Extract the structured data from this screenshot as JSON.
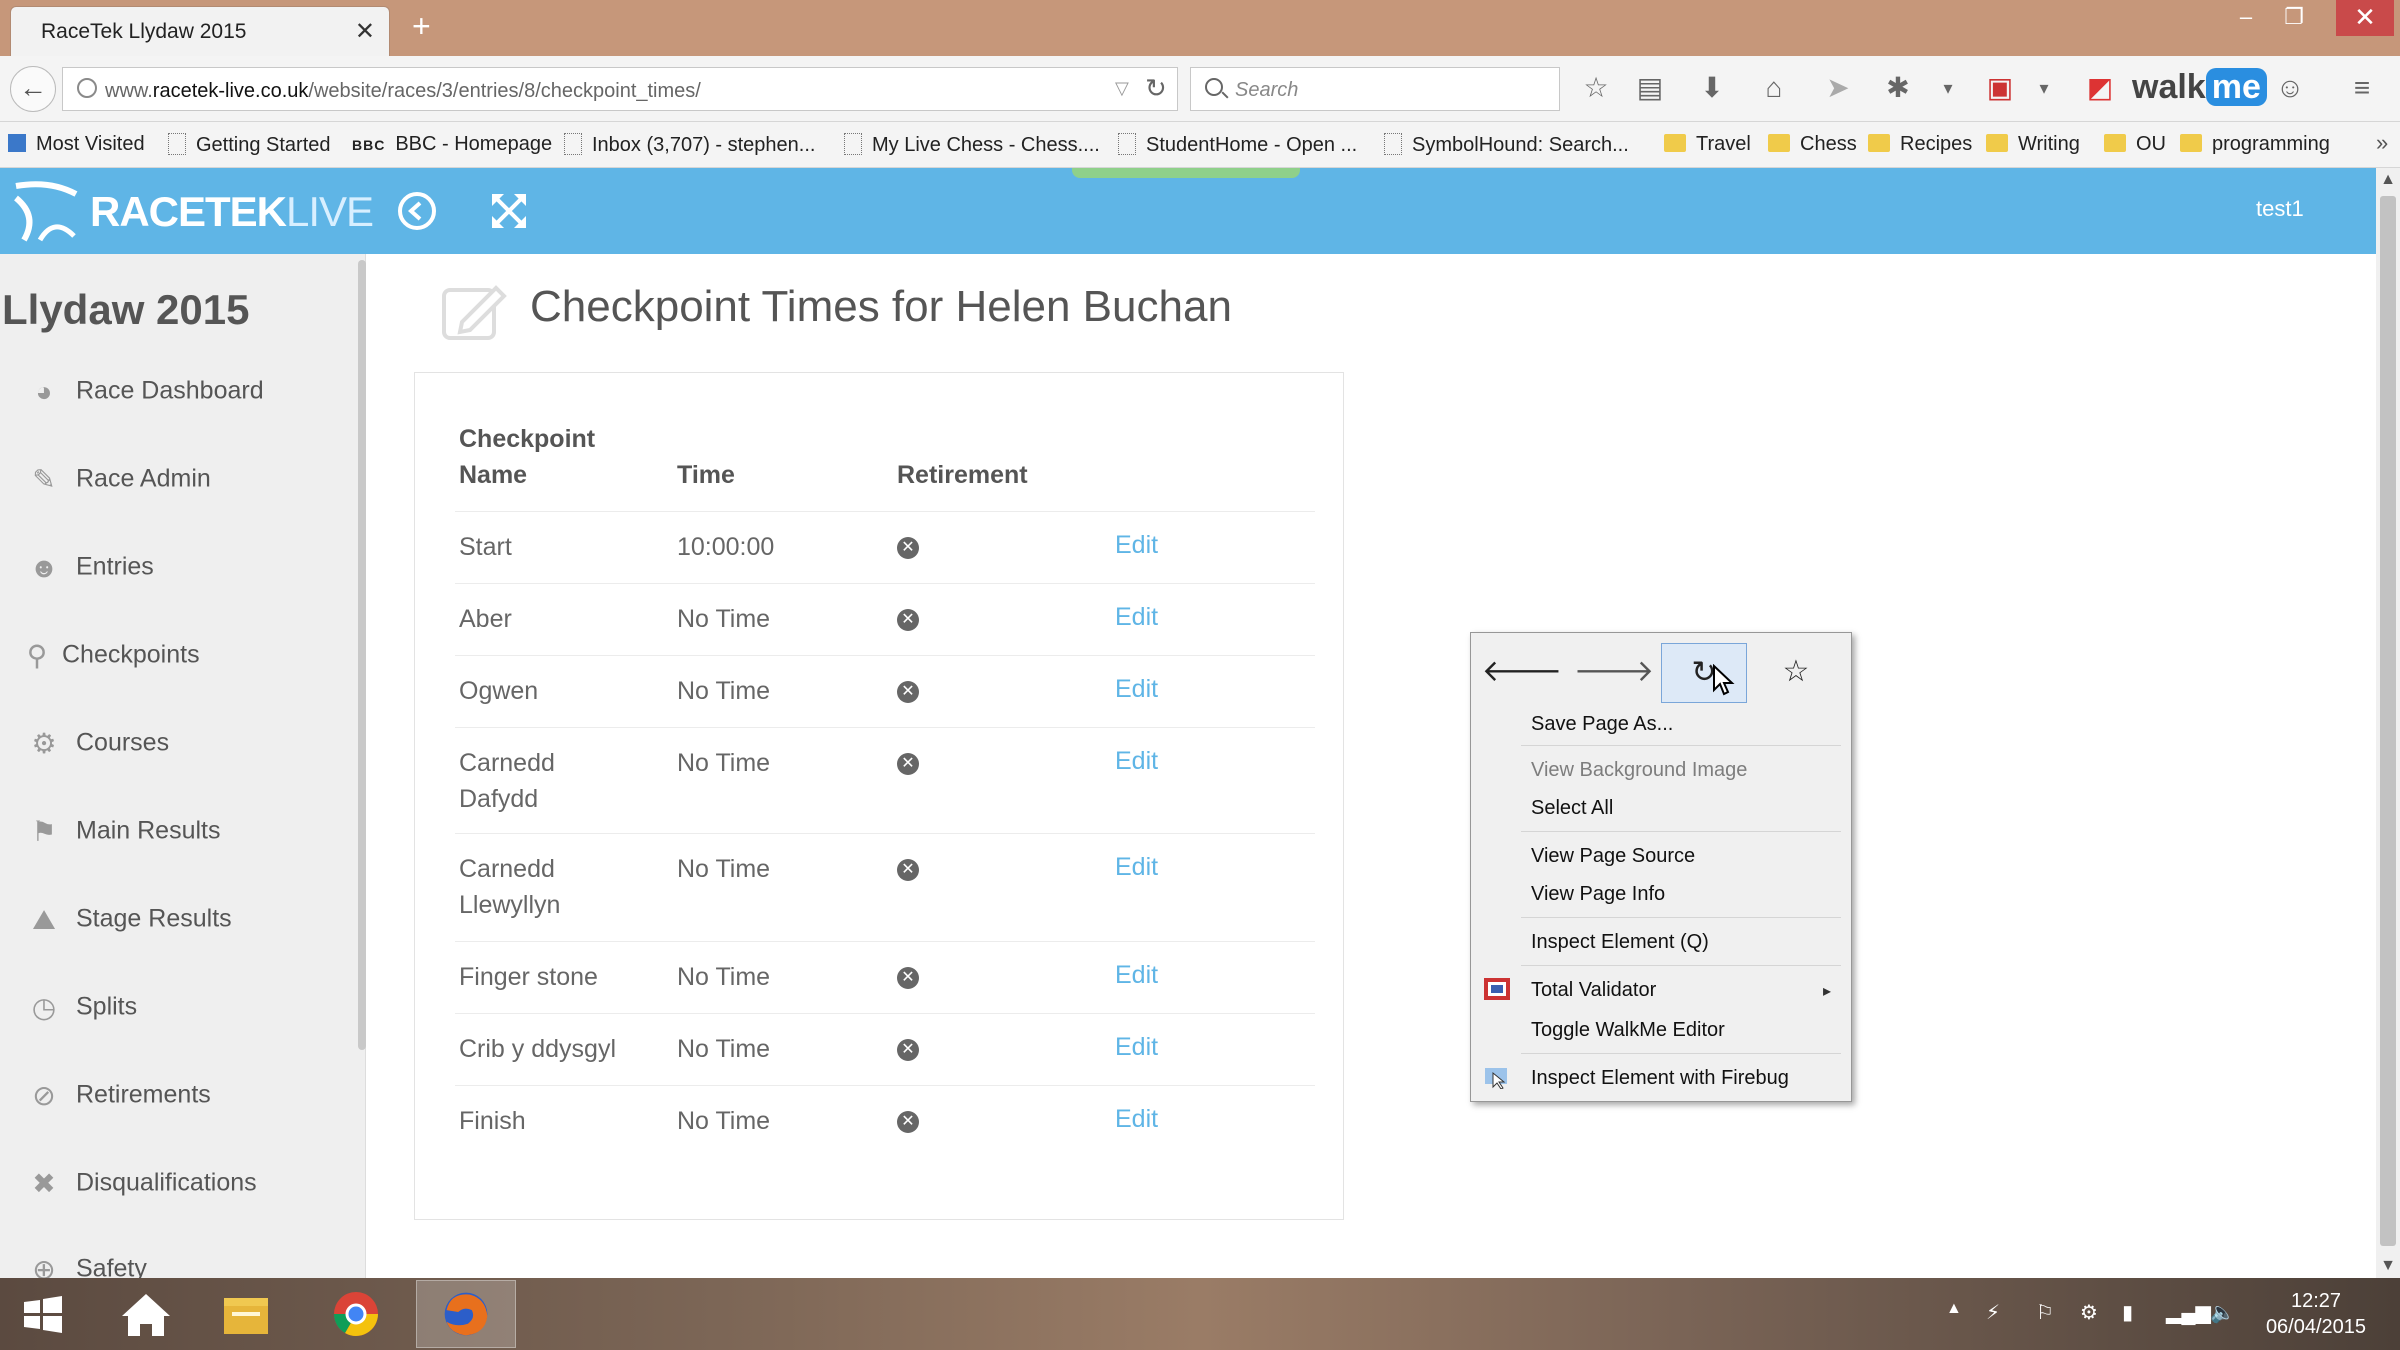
{
  "browser": {
    "tab_title": "RaceTek Llydaw 2015",
    "tab_close": "✕",
    "new_tab": "+",
    "url_prefix": "www.",
    "url_domain": "racetek-live.co.uk",
    "url_path": "/website/races/3/entries/8/checkpoint_times/",
    "search_placeholder": "Search",
    "window_min": "–",
    "window_max": "❐",
    "window_close": "✕",
    "walkme_a": "walk",
    "walkme_b": "me"
  },
  "bookmarks": [
    {
      "label": "Most Visited",
      "kind": "blue"
    },
    {
      "label": "Getting Started",
      "kind": "page"
    },
    {
      "label": "BBC - Homepage",
      "kind": "bbc"
    },
    {
      "label": "Inbox (3,707) - stephen...",
      "kind": "page"
    },
    {
      "label": "My Live Chess - Chess....",
      "kind": "page"
    },
    {
      "label": "StudentHome - Open ...",
      "kind": "page"
    },
    {
      "label": "SymbolHound: Search...",
      "kind": "page"
    },
    {
      "label": "Travel",
      "kind": "folder"
    },
    {
      "label": "Chess",
      "kind": "folder"
    },
    {
      "label": "Recipes",
      "kind": "folder"
    },
    {
      "label": "Writing",
      "kind": "folder"
    },
    {
      "label": "OU",
      "kind": "folder"
    },
    {
      "label": "programming",
      "kind": "folder"
    }
  ],
  "bbc_mark": "BBC",
  "bookmarks_more": "»",
  "app": {
    "logo_a": "RACETEK",
    "logo_b": "LIVE",
    "user": "test1",
    "event_title": "Llydaw 2015",
    "page_title": "Checkpoint Times for Helen Buchan",
    "colors": {
      "header": "#5fb5e6",
      "link": "#5fb5e6"
    }
  },
  "sidebar": {
    "items": [
      {
        "label": "Race Dashboard",
        "icon": "dashboard-icon"
      },
      {
        "label": "Race Admin",
        "icon": "edit-icon"
      },
      {
        "label": "Entries",
        "icon": "users-icon"
      },
      {
        "label": "Checkpoints",
        "icon": "map-marker-icon"
      },
      {
        "label": "Courses",
        "icon": "cogs-icon"
      },
      {
        "label": "Main Results",
        "icon": "flag-icon"
      },
      {
        "label": "Stage Results",
        "icon": "road-icon"
      },
      {
        "label": "Splits",
        "icon": "clock-icon"
      },
      {
        "label": "Retirements",
        "icon": "ban-icon"
      },
      {
        "label": "Disqualifications",
        "icon": "times-icon"
      },
      {
        "label": "Safety",
        "icon": "life-ring-icon"
      }
    ]
  },
  "table": {
    "headers": {
      "checkpoint_line1": "Checkpoint",
      "checkpoint_line2": "Name",
      "time": "Time",
      "retirement": "Retirement"
    },
    "edit_label": "Edit",
    "retire_glyph": "✕",
    "rows": [
      {
        "name1": "Start",
        "name2": "",
        "time": "10:00:00"
      },
      {
        "name1": "Aber",
        "name2": "",
        "time": "No Time"
      },
      {
        "name1": "Ogwen",
        "name2": "",
        "time": "No Time"
      },
      {
        "name1": "Carnedd",
        "name2": "Dafydd",
        "time": "No Time"
      },
      {
        "name1": "Carnedd",
        "name2": "Llewyllyn",
        "time": "No Time"
      },
      {
        "name1": "Finger stone",
        "name2": "",
        "time": "No Time"
      },
      {
        "name1": "Crib y ddysgyl",
        "name2": "",
        "time": "No Time"
      },
      {
        "name1": "Finish",
        "name2": "",
        "time": "No Time"
      }
    ]
  },
  "context_menu": {
    "back": "🡐",
    "forward": "🡒",
    "reload": "↻",
    "bookmark": "☆",
    "save_page_as": "Save Page As...",
    "view_background_image": "View Background Image",
    "select_all": "Select All",
    "view_page_source": "View Page Source",
    "view_page_info": "View Page Info",
    "inspect_element": "Inspect Element (Q)",
    "total_validator": "Total Validator",
    "submenu_arrow": "▸",
    "toggle_walkme": "Toggle WalkMe Editor",
    "inspect_firebug": "Inspect Element with Firebug"
  },
  "scrollbar": {
    "up": "▲",
    "down": "▼"
  },
  "taskbar": {
    "time": "12:27",
    "date": "06/04/2015",
    "tray_arrow": "▲"
  }
}
